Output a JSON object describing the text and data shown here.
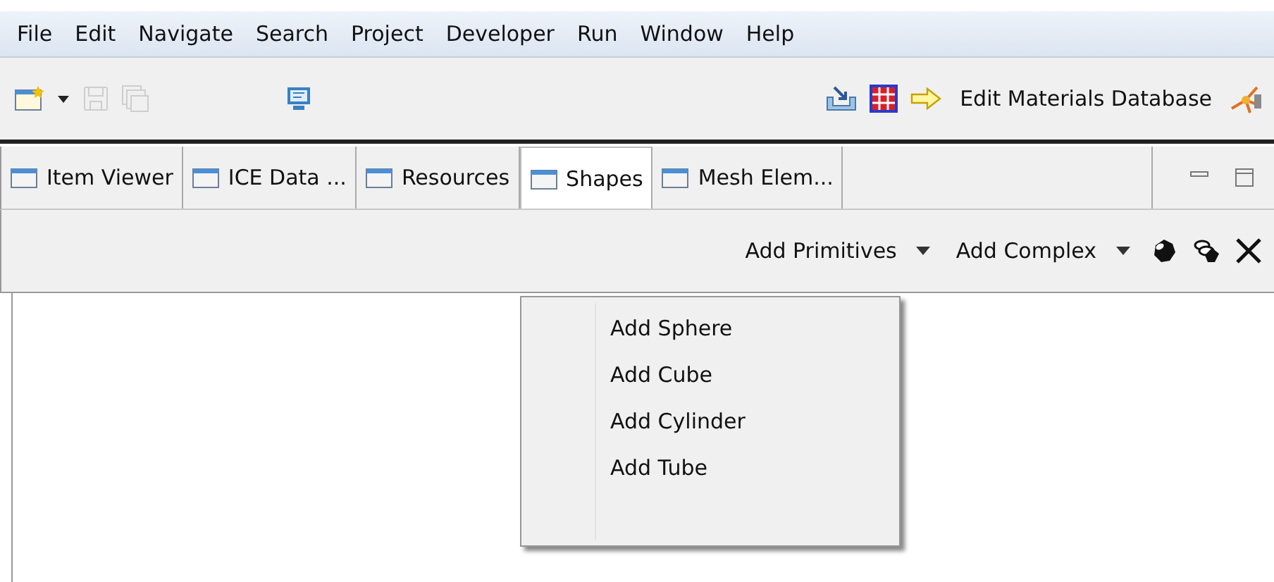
{
  "menu_bar": [
    "File",
    "Edit",
    "Navigate",
    "Search",
    "Project",
    "Developer",
    "Run",
    "Window",
    "Help"
  ],
  "toolbar": {
    "buttons": [
      {
        "kind": "new",
        "disabled": false
      },
      {
        "kind": "dropdown",
        "disabled": false
      },
      {
        "kind": "save",
        "disabled": true
      },
      {
        "kind": "save-all",
        "disabled": true
      },
      {
        "kind": "monitor",
        "disabled": false
      }
    ],
    "right_buttons": [
      {
        "kind": "import"
      },
      {
        "kind": "grid"
      },
      {
        "kind": "arrow"
      }
    ],
    "action_label": "Edit Materials Database"
  },
  "tabs": [
    {
      "label": "Item Viewer",
      "selected": false
    },
    {
      "label": "ICE Data ...",
      "selected": false
    },
    {
      "label": "Resources",
      "selected": false
    },
    {
      "label": "Shapes",
      "selected": true
    },
    {
      "label": "Mesh Elem...",
      "selected": false
    }
  ],
  "shapes_toolbar": {
    "dropdowns": [
      "Add Primitives",
      "Add Complex"
    ]
  },
  "popup_menu": {
    "items": [
      "Add Sphere",
      "Add Cube",
      "Add Cylinder",
      "Add Tube"
    ]
  }
}
